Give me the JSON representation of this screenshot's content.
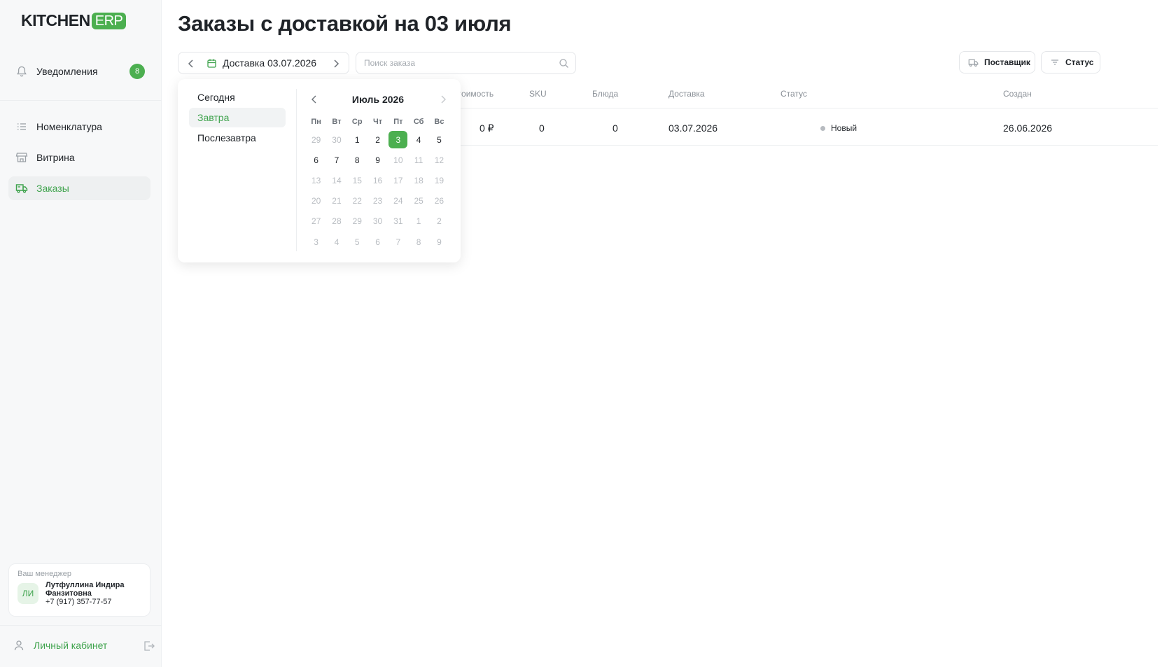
{
  "brand": {
    "name": "KITCHEN",
    "suffix": "ERP"
  },
  "sidebar": {
    "notifications": {
      "label": "Уведомления",
      "count": "8"
    },
    "items": [
      {
        "label": "Номенклатура",
        "icon": "list-icon",
        "active": false
      },
      {
        "label": "Витрина",
        "icon": "store-icon",
        "active": false
      },
      {
        "label": "Заказы",
        "icon": "truck-icon",
        "active": true
      }
    ],
    "manager": {
      "caption": "Ваш менеджер",
      "initials": "ЛИ",
      "name_line1": "Лутфуллина Индира",
      "name_line2": "Фанзитовна",
      "phone": "+7 (917) 357-77-57"
    },
    "cabinet_label": "Личный кабинет"
  },
  "header": {
    "title": "Заказы с доставкой на 03 июля",
    "date_label": "Доставка 03.07.2026",
    "search_placeholder": "Поиск заказа",
    "supplier_button": "Поставщик",
    "status_button": "Статус"
  },
  "table": {
    "columns": {
      "cost": "Стоимость",
      "sku": "SKU",
      "dishes": "Блюда",
      "delivery": "Доставка",
      "status": "Статус",
      "created": "Создан"
    },
    "rows": [
      {
        "cost": "0 ₽",
        "sku": "0",
        "dishes": "0",
        "delivery": "03.07.2026",
        "status": "Новый",
        "created": "26.06.2026"
      }
    ]
  },
  "calendar": {
    "quick": [
      "Сегодня",
      "Завтра",
      "Послезавтра"
    ],
    "quick_selected": "Завтра",
    "month": "Июль 2026",
    "weekdays": [
      "Пн",
      "Вт",
      "Ср",
      "Чт",
      "Пт",
      "Сб",
      "Вс"
    ],
    "days": [
      "29",
      "30",
      "1",
      "2",
      "3",
      "4",
      "5",
      "6",
      "7",
      "8",
      "9",
      "10",
      "11",
      "12",
      "13",
      "14",
      "15",
      "16",
      "17",
      "18",
      "19",
      "20",
      "21",
      "22",
      "23",
      "24",
      "25",
      "26",
      "27",
      "28",
      "29",
      "30",
      "31",
      "1",
      "2",
      "3",
      "4",
      "5",
      "6",
      "7",
      "8",
      "9"
    ],
    "current_days": [
      "1",
      "2",
      "3",
      "4",
      "5",
      "6",
      "7",
      "8",
      "9"
    ],
    "selected_day": "3",
    "colors": {
      "accent": "#4caf50",
      "accent_text": "#3fa34d"
    }
  }
}
